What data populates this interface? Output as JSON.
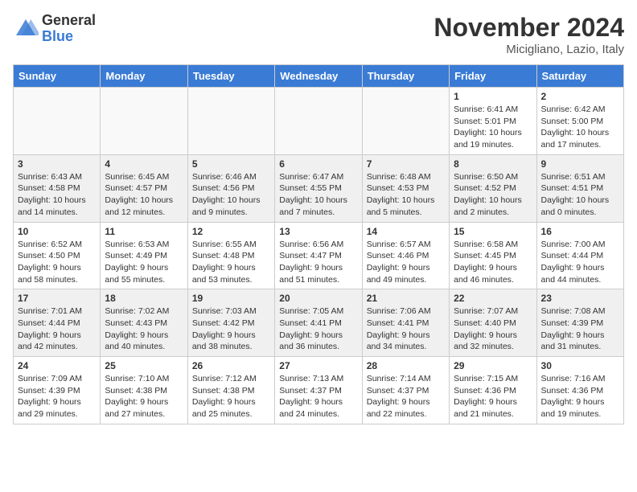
{
  "logo": {
    "general": "General",
    "blue": "Blue"
  },
  "title": "November 2024",
  "location": "Micigliano, Lazio, Italy",
  "days_of_week": [
    "Sunday",
    "Monday",
    "Tuesday",
    "Wednesday",
    "Thursday",
    "Friday",
    "Saturday"
  ],
  "weeks": [
    {
      "shade": false,
      "days": [
        {
          "num": "",
          "info": "",
          "empty": true
        },
        {
          "num": "",
          "info": "",
          "empty": true
        },
        {
          "num": "",
          "info": "",
          "empty": true
        },
        {
          "num": "",
          "info": "",
          "empty": true
        },
        {
          "num": "",
          "info": "",
          "empty": true
        },
        {
          "num": "1",
          "info": "Sunrise: 6:41 AM\nSunset: 5:01 PM\nDaylight: 10 hours\nand 19 minutes.",
          "empty": false
        },
        {
          "num": "2",
          "info": "Sunrise: 6:42 AM\nSunset: 5:00 PM\nDaylight: 10 hours\nand 17 minutes.",
          "empty": false
        }
      ]
    },
    {
      "shade": true,
      "days": [
        {
          "num": "3",
          "info": "Sunrise: 6:43 AM\nSunset: 4:58 PM\nDaylight: 10 hours\nand 14 minutes.",
          "empty": false
        },
        {
          "num": "4",
          "info": "Sunrise: 6:45 AM\nSunset: 4:57 PM\nDaylight: 10 hours\nand 12 minutes.",
          "empty": false
        },
        {
          "num": "5",
          "info": "Sunrise: 6:46 AM\nSunset: 4:56 PM\nDaylight: 10 hours\nand 9 minutes.",
          "empty": false
        },
        {
          "num": "6",
          "info": "Sunrise: 6:47 AM\nSunset: 4:55 PM\nDaylight: 10 hours\nand 7 minutes.",
          "empty": false
        },
        {
          "num": "7",
          "info": "Sunrise: 6:48 AM\nSunset: 4:53 PM\nDaylight: 10 hours\nand 5 minutes.",
          "empty": false
        },
        {
          "num": "8",
          "info": "Sunrise: 6:50 AM\nSunset: 4:52 PM\nDaylight: 10 hours\nand 2 minutes.",
          "empty": false
        },
        {
          "num": "9",
          "info": "Sunrise: 6:51 AM\nSunset: 4:51 PM\nDaylight: 10 hours\nand 0 minutes.",
          "empty": false
        }
      ]
    },
    {
      "shade": false,
      "days": [
        {
          "num": "10",
          "info": "Sunrise: 6:52 AM\nSunset: 4:50 PM\nDaylight: 9 hours\nand 58 minutes.",
          "empty": false
        },
        {
          "num": "11",
          "info": "Sunrise: 6:53 AM\nSunset: 4:49 PM\nDaylight: 9 hours\nand 55 minutes.",
          "empty": false
        },
        {
          "num": "12",
          "info": "Sunrise: 6:55 AM\nSunset: 4:48 PM\nDaylight: 9 hours\nand 53 minutes.",
          "empty": false
        },
        {
          "num": "13",
          "info": "Sunrise: 6:56 AM\nSunset: 4:47 PM\nDaylight: 9 hours\nand 51 minutes.",
          "empty": false
        },
        {
          "num": "14",
          "info": "Sunrise: 6:57 AM\nSunset: 4:46 PM\nDaylight: 9 hours\nand 49 minutes.",
          "empty": false
        },
        {
          "num": "15",
          "info": "Sunrise: 6:58 AM\nSunset: 4:45 PM\nDaylight: 9 hours\nand 46 minutes.",
          "empty": false
        },
        {
          "num": "16",
          "info": "Sunrise: 7:00 AM\nSunset: 4:44 PM\nDaylight: 9 hours\nand 44 minutes.",
          "empty": false
        }
      ]
    },
    {
      "shade": true,
      "days": [
        {
          "num": "17",
          "info": "Sunrise: 7:01 AM\nSunset: 4:44 PM\nDaylight: 9 hours\nand 42 minutes.",
          "empty": false
        },
        {
          "num": "18",
          "info": "Sunrise: 7:02 AM\nSunset: 4:43 PM\nDaylight: 9 hours\nand 40 minutes.",
          "empty": false
        },
        {
          "num": "19",
          "info": "Sunrise: 7:03 AM\nSunset: 4:42 PM\nDaylight: 9 hours\nand 38 minutes.",
          "empty": false
        },
        {
          "num": "20",
          "info": "Sunrise: 7:05 AM\nSunset: 4:41 PM\nDaylight: 9 hours\nand 36 minutes.",
          "empty": false
        },
        {
          "num": "21",
          "info": "Sunrise: 7:06 AM\nSunset: 4:41 PM\nDaylight: 9 hours\nand 34 minutes.",
          "empty": false
        },
        {
          "num": "22",
          "info": "Sunrise: 7:07 AM\nSunset: 4:40 PM\nDaylight: 9 hours\nand 32 minutes.",
          "empty": false
        },
        {
          "num": "23",
          "info": "Sunrise: 7:08 AM\nSunset: 4:39 PM\nDaylight: 9 hours\nand 31 minutes.",
          "empty": false
        }
      ]
    },
    {
      "shade": false,
      "days": [
        {
          "num": "24",
          "info": "Sunrise: 7:09 AM\nSunset: 4:39 PM\nDaylight: 9 hours\nand 29 minutes.",
          "empty": false
        },
        {
          "num": "25",
          "info": "Sunrise: 7:10 AM\nSunset: 4:38 PM\nDaylight: 9 hours\nand 27 minutes.",
          "empty": false
        },
        {
          "num": "26",
          "info": "Sunrise: 7:12 AM\nSunset: 4:38 PM\nDaylight: 9 hours\nand 25 minutes.",
          "empty": false
        },
        {
          "num": "27",
          "info": "Sunrise: 7:13 AM\nSunset: 4:37 PM\nDaylight: 9 hours\nand 24 minutes.",
          "empty": false
        },
        {
          "num": "28",
          "info": "Sunrise: 7:14 AM\nSunset: 4:37 PM\nDaylight: 9 hours\nand 22 minutes.",
          "empty": false
        },
        {
          "num": "29",
          "info": "Sunrise: 7:15 AM\nSunset: 4:36 PM\nDaylight: 9 hours\nand 21 minutes.",
          "empty": false
        },
        {
          "num": "30",
          "info": "Sunrise: 7:16 AM\nSunset: 4:36 PM\nDaylight: 9 hours\nand 19 minutes.",
          "empty": false
        }
      ]
    }
  ]
}
